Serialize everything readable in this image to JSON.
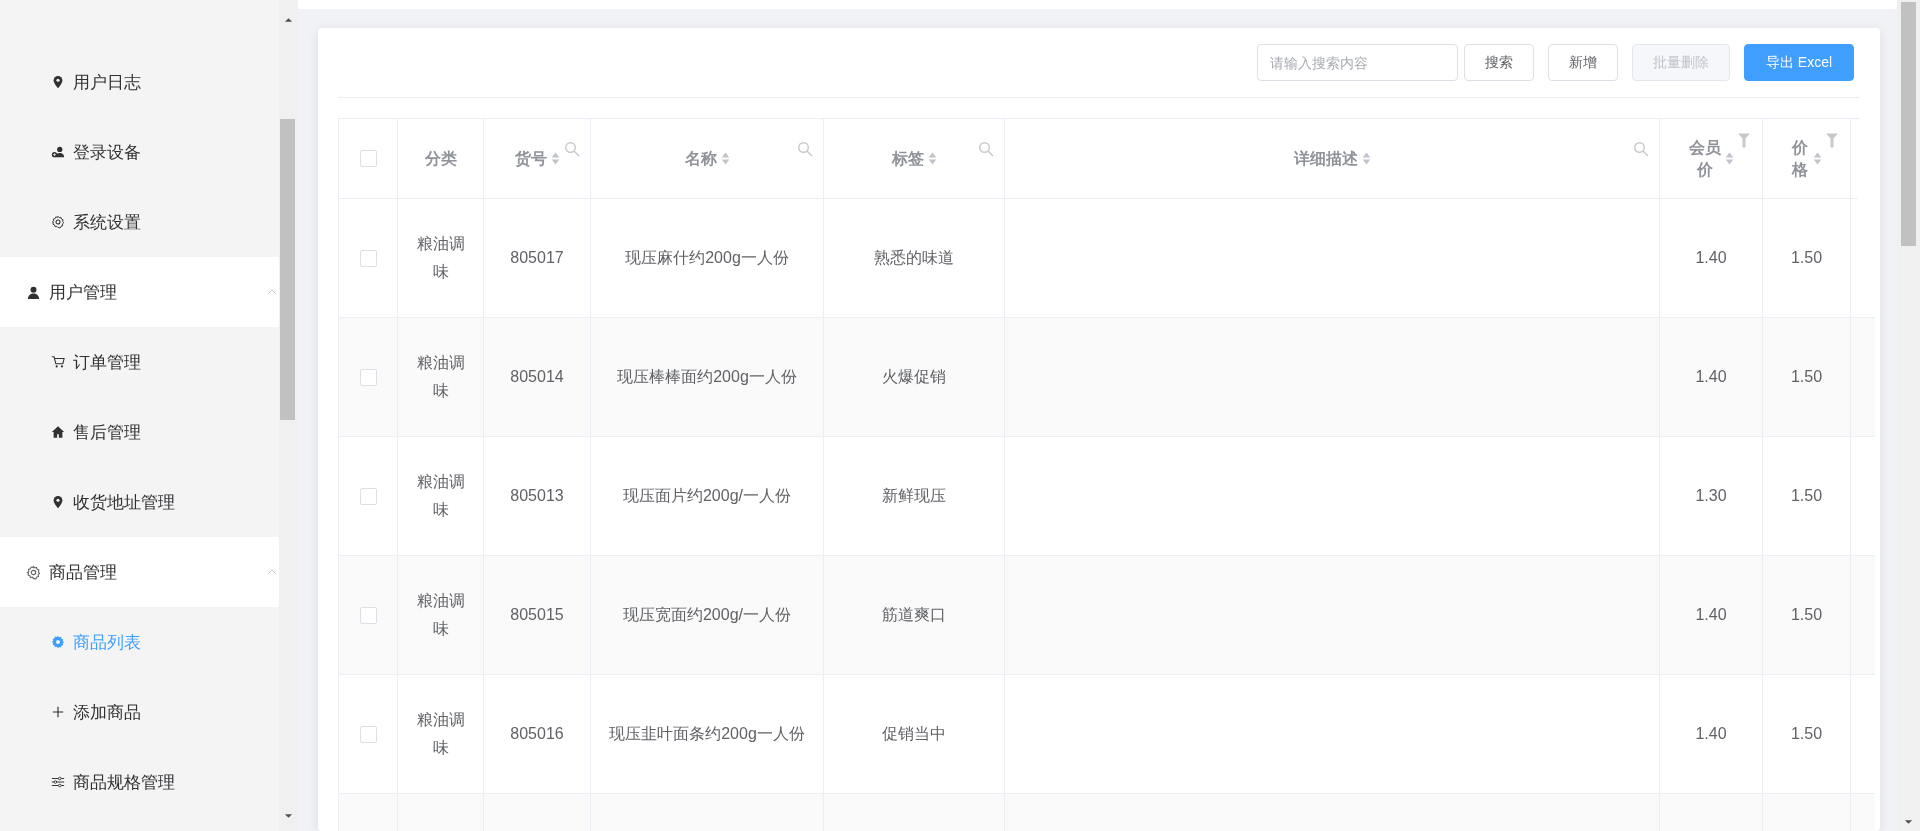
{
  "sidebar": {
    "items": [
      {
        "kind": "item",
        "label": "用户日志",
        "selected": false
      },
      {
        "kind": "item",
        "label": "登录设备",
        "selected": false
      },
      {
        "kind": "item",
        "label": "系统设置",
        "selected": false
      },
      {
        "kind": "group",
        "label": "用户管理",
        "expanded": true
      },
      {
        "kind": "item",
        "label": "订单管理",
        "selected": false
      },
      {
        "kind": "item",
        "label": "售后管理",
        "selected": false
      },
      {
        "kind": "item",
        "label": "收货地址管理",
        "selected": false
      },
      {
        "kind": "group",
        "label": "商品管理",
        "expanded": true
      },
      {
        "kind": "item",
        "label": "商品列表",
        "selected": true
      },
      {
        "kind": "item",
        "label": "添加商品",
        "selected": false
      },
      {
        "kind": "item",
        "label": "商品规格管理",
        "selected": false
      }
    ]
  },
  "toolbar": {
    "search": {
      "placeholder": "请输入搜索内容"
    },
    "buttons": [
      {
        "label": "搜索",
        "kind": "default",
        "disabled": false
      },
      {
        "label": "新增",
        "kind": "default",
        "disabled": false
      },
      {
        "label": "批量删除",
        "kind": "default",
        "disabled": true
      },
      {
        "label": "导出 Excel",
        "kind": "primary",
        "disabled": false
      }
    ]
  },
  "table": {
    "select_all": {
      "checked": false
    },
    "columns": [
      {
        "label": "分类",
        "sortable": false,
        "searchable": false,
        "filterable": false
      },
      {
        "label": "货号",
        "sortable": true,
        "searchable": true,
        "filterable": false
      },
      {
        "label": "名称",
        "sortable": true,
        "searchable": true,
        "filterable": false
      },
      {
        "label": "标签",
        "sortable": true,
        "searchable": true,
        "filterable": false
      },
      {
        "label": "详细描述",
        "sortable": true,
        "searchable": true,
        "filterable": false
      },
      {
        "label": "会员价",
        "sortable": true,
        "searchable": false,
        "filterable": true
      },
      {
        "label": "价格",
        "sortable": true,
        "searchable": false,
        "filterable": true
      }
    ],
    "rows": [
      {
        "checked": false,
        "category": "粮油调味",
        "sku": "805017",
        "name": "现压麻什约200g一人份",
        "tag": "熟悉的味道",
        "member_price": "1.40",
        "price": "1.50"
      },
      {
        "checked": false,
        "category": "粮油调味",
        "sku": "805014",
        "name": "现压棒棒面约200g一人份",
        "tag": "火爆促销",
        "member_price": "1.40",
        "price": "1.50"
      },
      {
        "checked": false,
        "category": "粮油调味",
        "sku": "805013",
        "name": "现压面片约200g/一人份",
        "tag": "新鲜现压",
        "member_price": "1.30",
        "price": "1.50"
      },
      {
        "checked": false,
        "category": "粮油调味",
        "sku": "805015",
        "name": "现压宽面约200g/一人份",
        "tag": "筋道爽口",
        "member_price": "1.40",
        "price": "1.50"
      },
      {
        "checked": false,
        "category": "粮油调味",
        "sku": "805016",
        "name": "现压韭叶面条约200g一人份",
        "tag": "促销当中",
        "member_price": "1.40",
        "price": "1.50"
      }
    ]
  }
}
